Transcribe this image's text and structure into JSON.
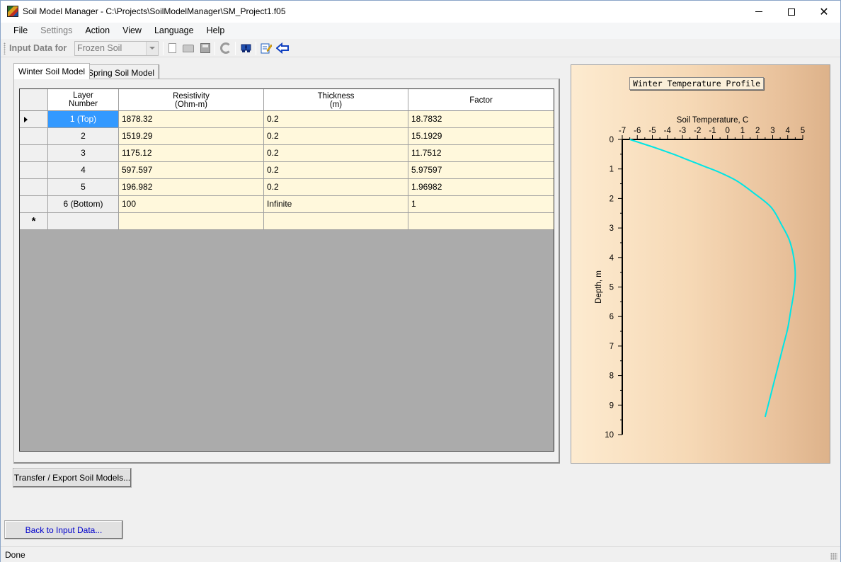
{
  "window": {
    "title": "Soil Model Manager - C:\\Projects\\SoilModelManager\\SM_Project1.f05",
    "app_icon": "soil-model-icon"
  },
  "menu": [
    {
      "label": "File",
      "enabled": true
    },
    {
      "label": "Settings",
      "enabled": false
    },
    {
      "label": "Action",
      "enabled": true
    },
    {
      "label": "View",
      "enabled": true
    },
    {
      "label": "Language",
      "enabled": true
    },
    {
      "label": "Help",
      "enabled": true
    }
  ],
  "toolbar": {
    "input_label": "Input Data for",
    "soil_type_selected": "Frozen Soil",
    "icons": [
      "new-file-icon",
      "open-folder-icon",
      "save-icon",
      "refresh-icon",
      "find-icon",
      "edit-icon",
      "back-arrow-icon"
    ]
  },
  "tabs": [
    {
      "label": "Winter Soil Model",
      "active": true
    },
    {
      "label": "Spring Soil Model",
      "active": false
    }
  ],
  "grid": {
    "headers": {
      "layer": [
        "Layer",
        "Number"
      ],
      "resistivity": [
        "Resistivity",
        "(Ohm-m)"
      ],
      "thickness": [
        "Thickness",
        "(m)"
      ],
      "factor": [
        "Factor"
      ]
    },
    "rows": [
      {
        "layer": "1 (Top)",
        "resistivity": "1878.32",
        "thickness": "0.2",
        "factor": "18.7832"
      },
      {
        "layer": "2",
        "resistivity": "1519.29",
        "thickness": "0.2",
        "factor": "15.1929"
      },
      {
        "layer": "3",
        "resistivity": "1175.12",
        "thickness": "0.2",
        "factor": "11.7512"
      },
      {
        "layer": "4",
        "resistivity": "597.597",
        "thickness": "0.2",
        "factor": "5.97597"
      },
      {
        "layer": "5",
        "resistivity": "196.982",
        "thickness": "0.2",
        "factor": "1.96982"
      },
      {
        "layer": "6 (Bottom)",
        "resistivity": "100",
        "thickness": "Infinite",
        "factor": "1"
      }
    ],
    "new_row_marker": "*"
  },
  "chart_data": {
    "type": "line",
    "title": "Winter Temperature Profile",
    "xlabel": "Soil Temperature, C",
    "ylabel": "Depth, m",
    "xlim": [
      -7,
      5
    ],
    "ylim": [
      0,
      10
    ],
    "y_inverted": true,
    "x_axis_position": "top",
    "x_ticks": [
      -7,
      -6,
      -5,
      -4,
      -3,
      -2,
      -1,
      0,
      1,
      2,
      3,
      4,
      5
    ],
    "y_ticks": [
      0,
      1,
      2,
      3,
      4,
      5,
      6,
      7,
      8,
      9,
      10
    ],
    "line_color": "#00e5e5",
    "series": [
      {
        "x": [
          -6.5,
          -5.6,
          -4.7,
          -3.6,
          -2.6,
          -1.6,
          -0.6,
          0.6,
          1.7,
          2.9,
          3.6,
          4.1,
          4.4,
          4.5,
          4.4,
          4.2,
          4.0,
          3.7,
          3.4,
          3.1,
          2.8,
          2.5
        ],
        "y": [
          0,
          0.15,
          0.3,
          0.5,
          0.7,
          0.9,
          1.1,
          1.4,
          1.8,
          2.3,
          2.9,
          3.4,
          4.0,
          4.6,
          5.2,
          5.8,
          6.4,
          7.0,
          7.6,
          8.2,
          8.8,
          9.4
        ]
      }
    ]
  },
  "buttons": {
    "transfer": "Transfer / Export Soil Models...",
    "back": "Back to Input Data..."
  },
  "status": {
    "text": "Done"
  }
}
